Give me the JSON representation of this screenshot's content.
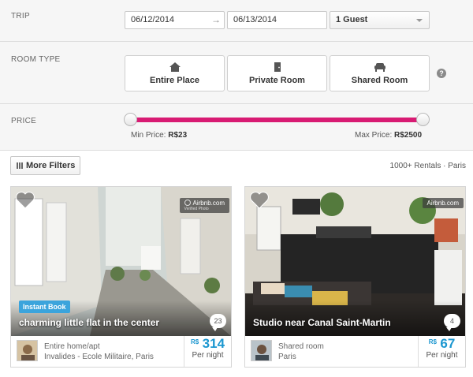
{
  "trip": {
    "label": "TRIP",
    "checkin": "06/12/2014",
    "checkout": "06/13/2014",
    "guests": "1 Guest"
  },
  "room_type": {
    "label": "ROOM TYPE",
    "options": [
      {
        "label": "Entire Place",
        "icon": "house-icon"
      },
      {
        "label": "Private Room",
        "icon": "door-icon"
      },
      {
        "label": "Shared Room",
        "icon": "couch-icon"
      }
    ],
    "help": "?"
  },
  "price": {
    "label": "PRICE",
    "min_label": "Min Price:",
    "min_value": "R$23",
    "max_label": "Max Price:",
    "max_value": "R$2500",
    "slider_min_fraction": 0,
    "slider_max_fraction": 1,
    "accent_color": "#d81b73"
  },
  "toolbar": {
    "more_filters_label": "More Filters",
    "results": "1000+ Rentals · Paris"
  },
  "listings": [
    {
      "title": "charming little flat in the center",
      "badge": "Instant Book",
      "watermark": "Airbnb.com",
      "watermark_sub": "Verified Photo",
      "comments": "23",
      "room_type": "Entire home/apt",
      "location": "Invalides - Ecole Militaire, Paris",
      "currency": "R$",
      "price": "314",
      "per": "Per night"
    },
    {
      "title": "Studio near Canal Saint-Martin",
      "badge": "",
      "watermark": "Airbnb.com",
      "watermark_sub": "",
      "comments": "4",
      "room_type": "Shared room",
      "location": "Paris",
      "currency": "R$",
      "price": "67",
      "per": "Per night"
    }
  ],
  "colors": {
    "price_text": "#1c97d0",
    "instant_badge": "#3ba4dc"
  }
}
